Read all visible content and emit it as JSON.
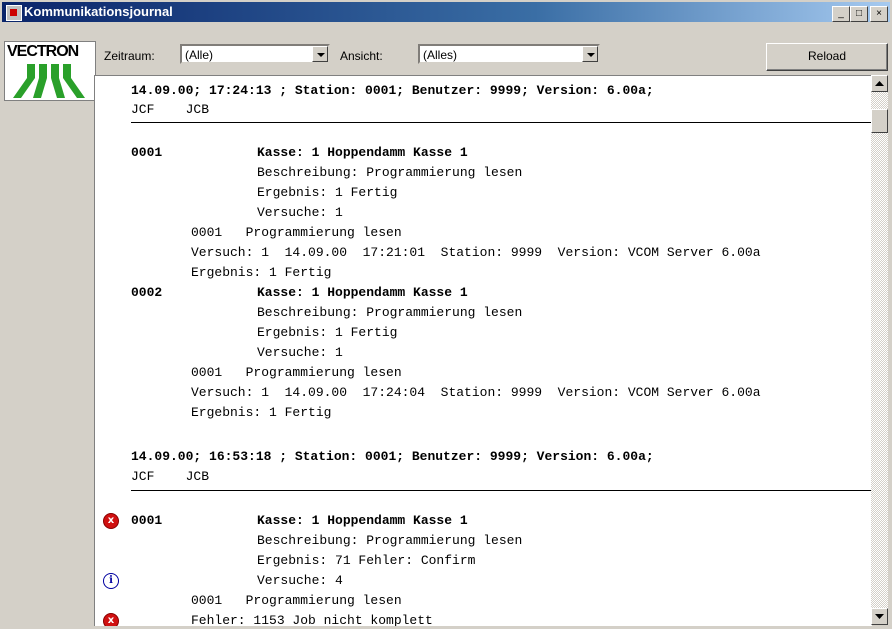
{
  "window": {
    "title": "Kommunikationsjournal",
    "controls": [
      "_",
      "□",
      "×"
    ]
  },
  "toolbar": {
    "logo_text": "VECTRON",
    "zeitraum_label": "Zeitraum:",
    "zeitraum_value": "(Alle)",
    "ansicht_label": "Ansicht:",
    "ansicht_value": "(Alles)",
    "reload_label": "Reload"
  },
  "journal": {
    "block1": {
      "header": "14.09.00; 17:24:13 ; Station: 0001; Benutzer: 9999; Version: 6.00a;",
      "cols": "JCF    JCB",
      "entries": [
        {
          "id": "0001",
          "kasse": "Kasse: 1 Hoppendamm Kasse 1",
          "beschreibung": "Beschreibung: Programmierung lesen",
          "ergebnis": "Ergebnis: 1 Fertig",
          "versuche": "Versuche: 1",
          "job": "0001   Programmierung lesen",
          "versuch": "Versuch: 1  14.09.00  17:21:01  Station: 9999  Version: VCOM Server 6.00a",
          "job_ergebnis": "Ergebnis: 1 Fertig"
        },
        {
          "id": "0002",
          "kasse": "Kasse: 1 Hoppendamm Kasse 1",
          "beschreibung": "Beschreibung: Programmierung lesen",
          "ergebnis": "Ergebnis: 1 Fertig",
          "versuche": "Versuche: 1",
          "job": "0001   Programmierung lesen",
          "versuch": "Versuch: 1  14.09.00  17:24:04  Station: 9999  Version: VCOM Server 6.00a",
          "job_ergebnis": "Ergebnis: 1 Fertig"
        }
      ]
    },
    "block2": {
      "header": "14.09.00; 16:53:18 ; Station: 0001; Benutzer: 9999; Version: 6.00a;",
      "cols": "JCF    JCB",
      "entry": {
        "id": "0001",
        "kasse": "Kasse: 1 Hoppendamm Kasse 1",
        "beschreibung": "Beschreibung: Programmierung lesen",
        "ergebnis": "Ergebnis: 71 Fehler: Confirm",
        "versuche": "Versuche: 4",
        "job": "0001   Programmierung lesen",
        "fehler": "Fehler: 1153 Job nicht komplett"
      }
    }
  },
  "icons": {
    "error_glyph": "x",
    "info_glyph": "i"
  }
}
